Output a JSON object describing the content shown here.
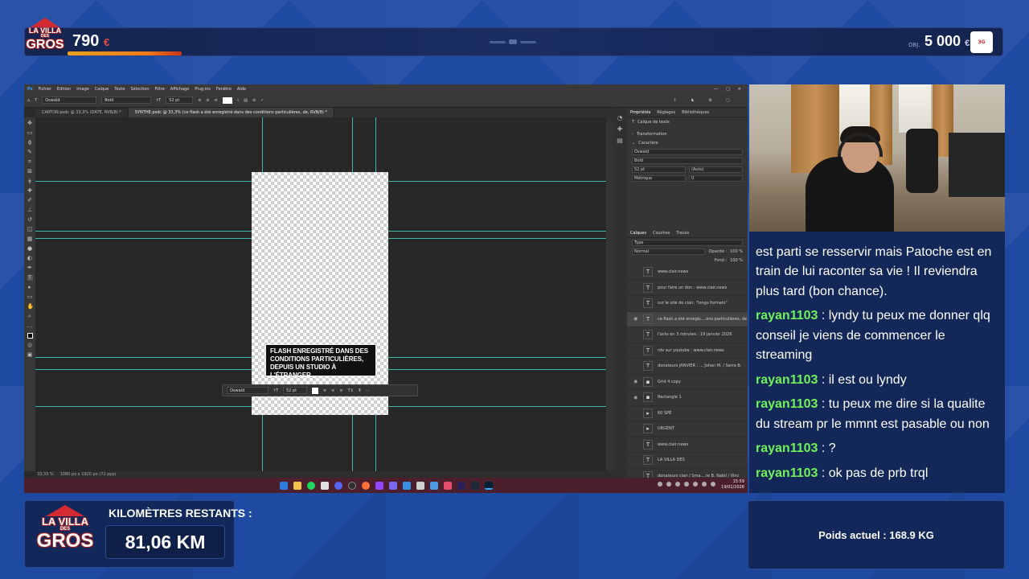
{
  "overlay": {
    "brand": {
      "line1": "LA VILLA",
      "line2": "DES",
      "line3": "GROS"
    },
    "donation": {
      "amount": "790",
      "currency": "€",
      "progress": 0.158,
      "goal_prefix": "OBJ.",
      "goal": "5 000",
      "goal_currency": "€"
    },
    "badge_text": "3G",
    "km": {
      "title": "KILOMÈTRES RESTANTS :",
      "value": "81,06 KM"
    },
    "weight": {
      "label": "Poids actuel : 168.9 KG"
    },
    "colors": {
      "accent_red": "#d42b33",
      "chat_user": "#6ff25a",
      "panel_bg": "#12285a"
    }
  },
  "photoshop": {
    "menu": [
      "Fichier",
      "Edition",
      "Image",
      "Calque",
      "Texte",
      "Sélection",
      "Filtre",
      "Affichage",
      "Plug-ins",
      "Fenêtre",
      "Aide"
    ],
    "options": {
      "font": "Oswald",
      "style": "Bold",
      "size": "52 pt"
    },
    "tabs": [
      "CARTON.psdc @ 33,3% (DATE, RVB/8) *",
      "SYNTHE.psdc @ 33,3% (ce flash a été enregistré dans des conditions particulières, de, RVB/8) *"
    ],
    "document_text": "FLASH ENREGISTRÉ DANS DES CONDITIONS PARTICULIÈRES, DEPUIS UN STUDIO À L'ÉTRANGER.",
    "floating_bar": {
      "font": "Oswald",
      "size": "52 pt"
    },
    "status": {
      "zoom": "33,33 %",
      "doc_info": "1080 px x 1920 px (72 ppp)"
    },
    "properties": {
      "tabs": [
        "Propriétés",
        "Réglages",
        "Bibliothèques"
      ],
      "layer_type": "Calque de texte",
      "section_transform": "Transformation",
      "section_char": "Caractère",
      "font": "Oswald",
      "style": "Bold",
      "size": "52 pt",
      "leading": "(Auto)",
      "kerning": "Métrique",
      "tracking": "0"
    },
    "layers_panel": {
      "tabs": [
        "Calques",
        "Couches",
        "Tracés"
      ],
      "search_placeholder": "Type",
      "blend": "Normal",
      "opacity_label": "Opacité :",
      "opacity": "100 %",
      "fill_label": "Fond :",
      "fill": "100 %",
      "layers": [
        {
          "name": "www.clair.news",
          "type": "T",
          "visible": false,
          "selected": false
        },
        {
          "name": "pour faire un don : www.clair.news",
          "type": "T",
          "visible": false,
          "selected": false
        },
        {
          "name": "sur le site de clair, \"longs formats\"",
          "type": "T",
          "visible": false,
          "selected": false
        },
        {
          "name": "ce flash a été enregis....ons particulières, de",
          "type": "T",
          "visible": true,
          "selected": true
        },
        {
          "name": "l'actu en 3 minutes : 19 janvier 2026",
          "type": "T",
          "visible": false,
          "selected": false
        },
        {
          "name": "rdv sur youtube : www.clair.news",
          "type": "T",
          "visible": false,
          "selected": false
        },
        {
          "name": "donateurs JANVIER : ... Johan M. / Sarra B.",
          "type": "T",
          "visible": false,
          "selected": false
        },
        {
          "name": "Grid 4 copy",
          "type": "img",
          "visible": true,
          "selected": false
        },
        {
          "name": "Rectangle 1",
          "type": "shape",
          "visible": true,
          "selected": false
        },
        {
          "name": "60 SPÉ",
          "type": "group",
          "visible": false,
          "selected": false
        },
        {
          "name": "URGENT",
          "type": "group",
          "visible": false,
          "selected": false
        },
        {
          "name": "www.clair.news",
          "type": "T",
          "visible": false,
          "selected": false
        },
        {
          "name": "LA VILLA DES",
          "type": "T",
          "visible": false,
          "selected": false
        },
        {
          "name": "donateurs clair / Sma....re B. Nabil / Vinc",
          "type": "T",
          "visible": false,
          "selected": false
        },
        {
          "name": "flash urgent : 7 janvier 2026",
          "type": "T",
          "visible": false,
          "selected": false
        }
      ]
    },
    "taskbar": {
      "time": "15:59",
      "date": "19/01/2026"
    }
  },
  "chat": {
    "messages": [
      {
        "user": "",
        "text": "est parti se resservir mais Patoche est en train de lui raconter sa vie ! Il reviendra plus tard (bon chance)."
      },
      {
        "user": "rayan1103",
        "text": "lyndy tu peux me donner qlq conseil je viens de commencer le streaming"
      },
      {
        "user": "rayan1103",
        "text": "il est ou lyndy"
      },
      {
        "user": "rayan1103",
        "text": "tu peux me dire si la qualite du stream pr le mmnt est pasable ou non"
      },
      {
        "user": "rayan1103",
        "text": "?"
      },
      {
        "user": "rayan1103",
        "text": "ok pas de prb trql"
      }
    ]
  }
}
